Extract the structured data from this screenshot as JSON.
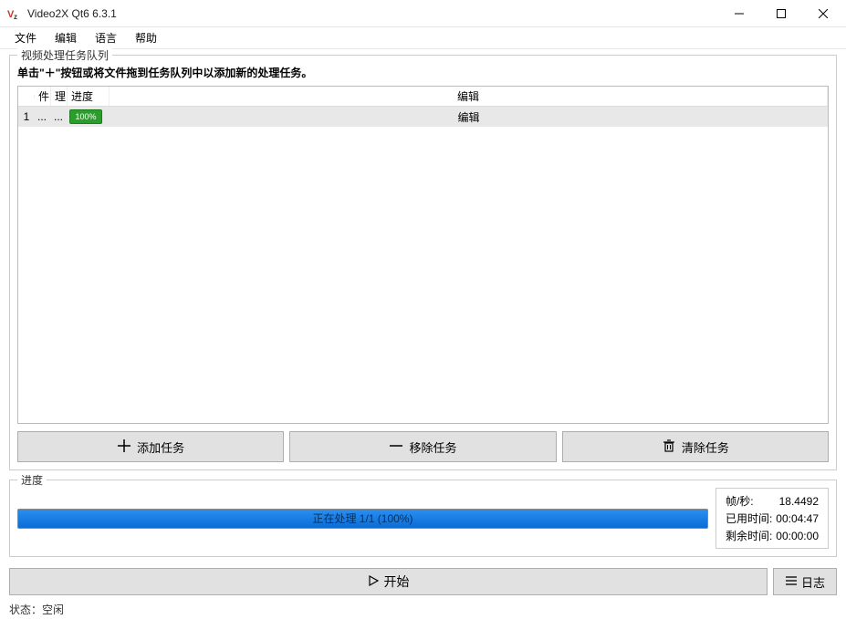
{
  "window": {
    "title": "Video2X Qt6 6.3.1"
  },
  "menu": {
    "file": "文件",
    "edit": "编辑",
    "language": "语言",
    "help": "帮助"
  },
  "queue": {
    "legend": "视频处理任务队列",
    "hint": "单击\"＋\"按钮或将文件拖到任务队列中以添加新的处理任务。",
    "headers": {
      "file": "件",
      "proc": "理",
      "progress": "进度",
      "edit": "编辑"
    },
    "rows": [
      {
        "index": "1",
        "file": "...",
        "proc": "...",
        "progress_text": "100%",
        "edit": "编辑"
      }
    ]
  },
  "actions": {
    "add": "添加任务",
    "remove": "移除任务",
    "clear": "清除任务"
  },
  "progress": {
    "legend": "进度",
    "bar_text": "正在处理 1/1 (100%)",
    "stats": {
      "fps_label": "帧/秒:",
      "fps_value": "18.4492",
      "elapsed_label": "已用时间:",
      "elapsed_value": "00:04:47",
      "remaining_label": "剩余时间:",
      "remaining_value": "00:00:00"
    }
  },
  "bottom": {
    "start": "开始",
    "log": "日志"
  },
  "status": {
    "label": "状态：",
    "value": "空闲"
  }
}
